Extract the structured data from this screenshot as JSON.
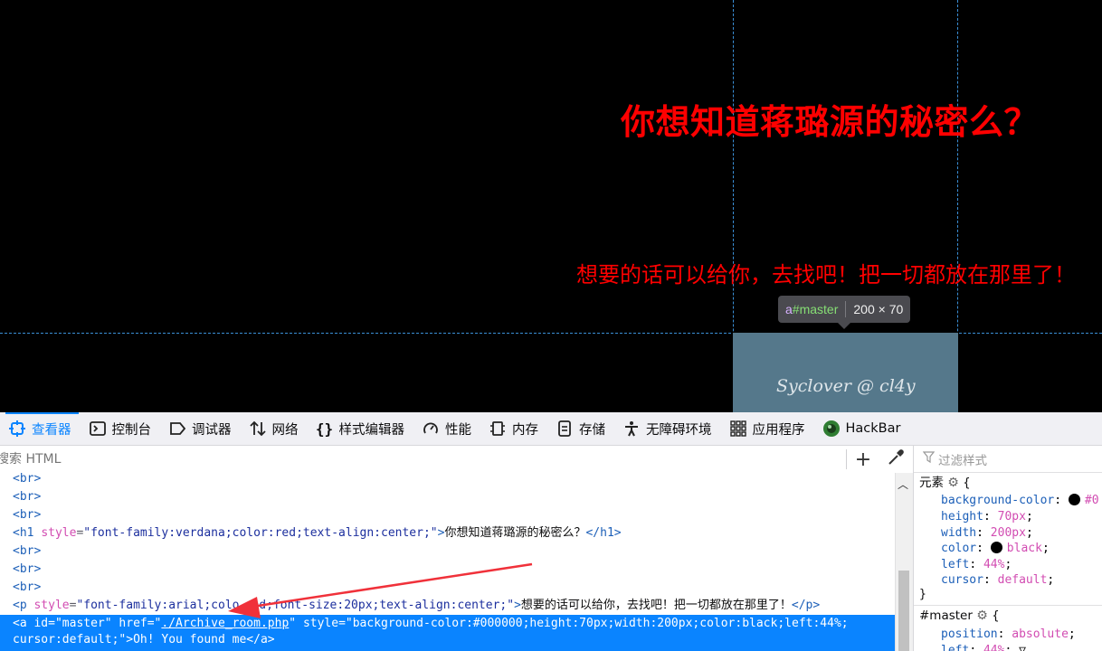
{
  "page": {
    "heading": "你想知道蒋璐源的秘密么？",
    "paragraph": "想要的话可以给你，去找吧！把一切都放在那里了！",
    "master_link_text": "Syclover @ cl4y",
    "tooltip": {
      "tag": "a",
      "id": "#master",
      "size": "200 × 70"
    }
  },
  "devtools": {
    "tabs": [
      {
        "label": "查看器",
        "icon": "inspector-icon"
      },
      {
        "label": "控制台",
        "icon": "console-icon"
      },
      {
        "label": "调试器",
        "icon": "debugger-icon"
      },
      {
        "label": "网络",
        "icon": "network-icon"
      },
      {
        "label": "样式编辑器",
        "icon": "style-editor-icon"
      },
      {
        "label": "性能",
        "icon": "performance-icon"
      },
      {
        "label": "内存",
        "icon": "memory-icon"
      },
      {
        "label": "存储",
        "icon": "storage-icon"
      },
      {
        "label": "无障碍环境",
        "icon": "accessibility-icon"
      },
      {
        "label": "应用程序",
        "icon": "application-icon"
      },
      {
        "label": "HackBar",
        "icon": "hackbar-icon"
      }
    ],
    "search_placeholder": "搜索 HTML",
    "markup": {
      "br": "<br>",
      "h1_open": "<h1",
      "h1_style_attr": "style",
      "h1_style_value": "\"font-family:verdana;color:red;text-align:center;\"",
      "h1_text": "你想知道蒋璐源的秘密么？",
      "h1_close": "</h1>",
      "p_open": "<p",
      "p_style_attr": "style",
      "p_style_value_a": "\"font-family:arial;colo",
      "p_style_value_b": "ed;font-size:20px;text-align:center;\"",
      "p_text": "想要的话可以给你，去找吧！把一切都放在那里了！",
      "p_close": "</p>",
      "a_open": "<a",
      "a_id_attr": "id",
      "a_id_value": "\"master\"",
      "a_href_attr": "href",
      "a_href_value": "./Archive_room.php",
      "a_style_attr": "style",
      "a_style_value": "\"background-color:#000000;height:70px;width:200px;color:black;left:44%;",
      "a_style_value_2": "cursor:default;\"",
      "a_text": "Oh! You found me",
      "a_close": "</a>"
    },
    "rules": {
      "filter_placeholder": "过滤样式",
      "element_label": "元素",
      "element_decls": [
        {
          "prop": "background-color",
          "value": "#0"
        },
        {
          "prop": "height",
          "value": "70px"
        },
        {
          "prop": "width",
          "value": "200px"
        },
        {
          "prop": "color",
          "value": "black"
        },
        {
          "prop": "left",
          "value": "44%"
        },
        {
          "prop": "cursor",
          "value": "default"
        }
      ],
      "master_selector": "#master",
      "master_decls": [
        {
          "prop": "position",
          "value": "absolute"
        },
        {
          "prop": "left",
          "value": "44%"
        }
      ]
    }
  },
  "colors": {
    "heading": "#ff0000",
    "highlight": "#0a84ff",
    "box_highlight": "#55788b",
    "guide": "#3a8fd6"
  }
}
